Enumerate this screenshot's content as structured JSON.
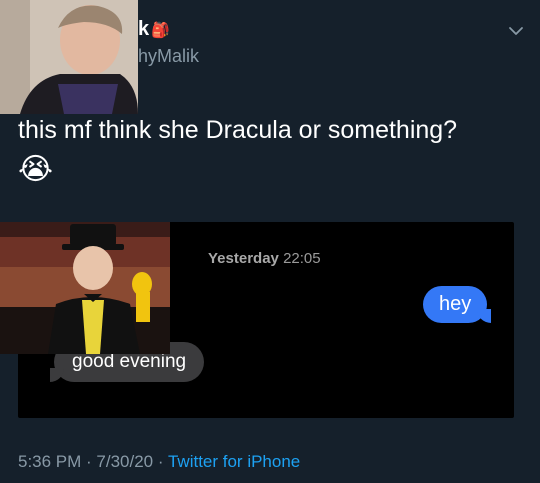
{
  "tweet": {
    "display_name_fragment": "k",
    "display_name_emoji": "🎒",
    "handle_fragment": "hyMalik",
    "text": "this mf think she Dracula or something?",
    "text_emoji": "😭"
  },
  "media": {
    "timestamp_day": "Yesterday",
    "timestamp_time": "22:05",
    "sent_message": "hey",
    "received_message": "good evening"
  },
  "footer": {
    "time": "5:36 PM",
    "separator1": " · ",
    "date": "7/30/20",
    "separator2": " · ",
    "source": "Twitter for iPhone"
  },
  "icons": {
    "menu": "chevron-down-icon"
  },
  "colors": {
    "background": "#15202b",
    "sent_bubble": "#3478f6",
    "received_bubble": "#3b3b3d",
    "link": "#1da1f2",
    "muted": "#8899a6"
  }
}
